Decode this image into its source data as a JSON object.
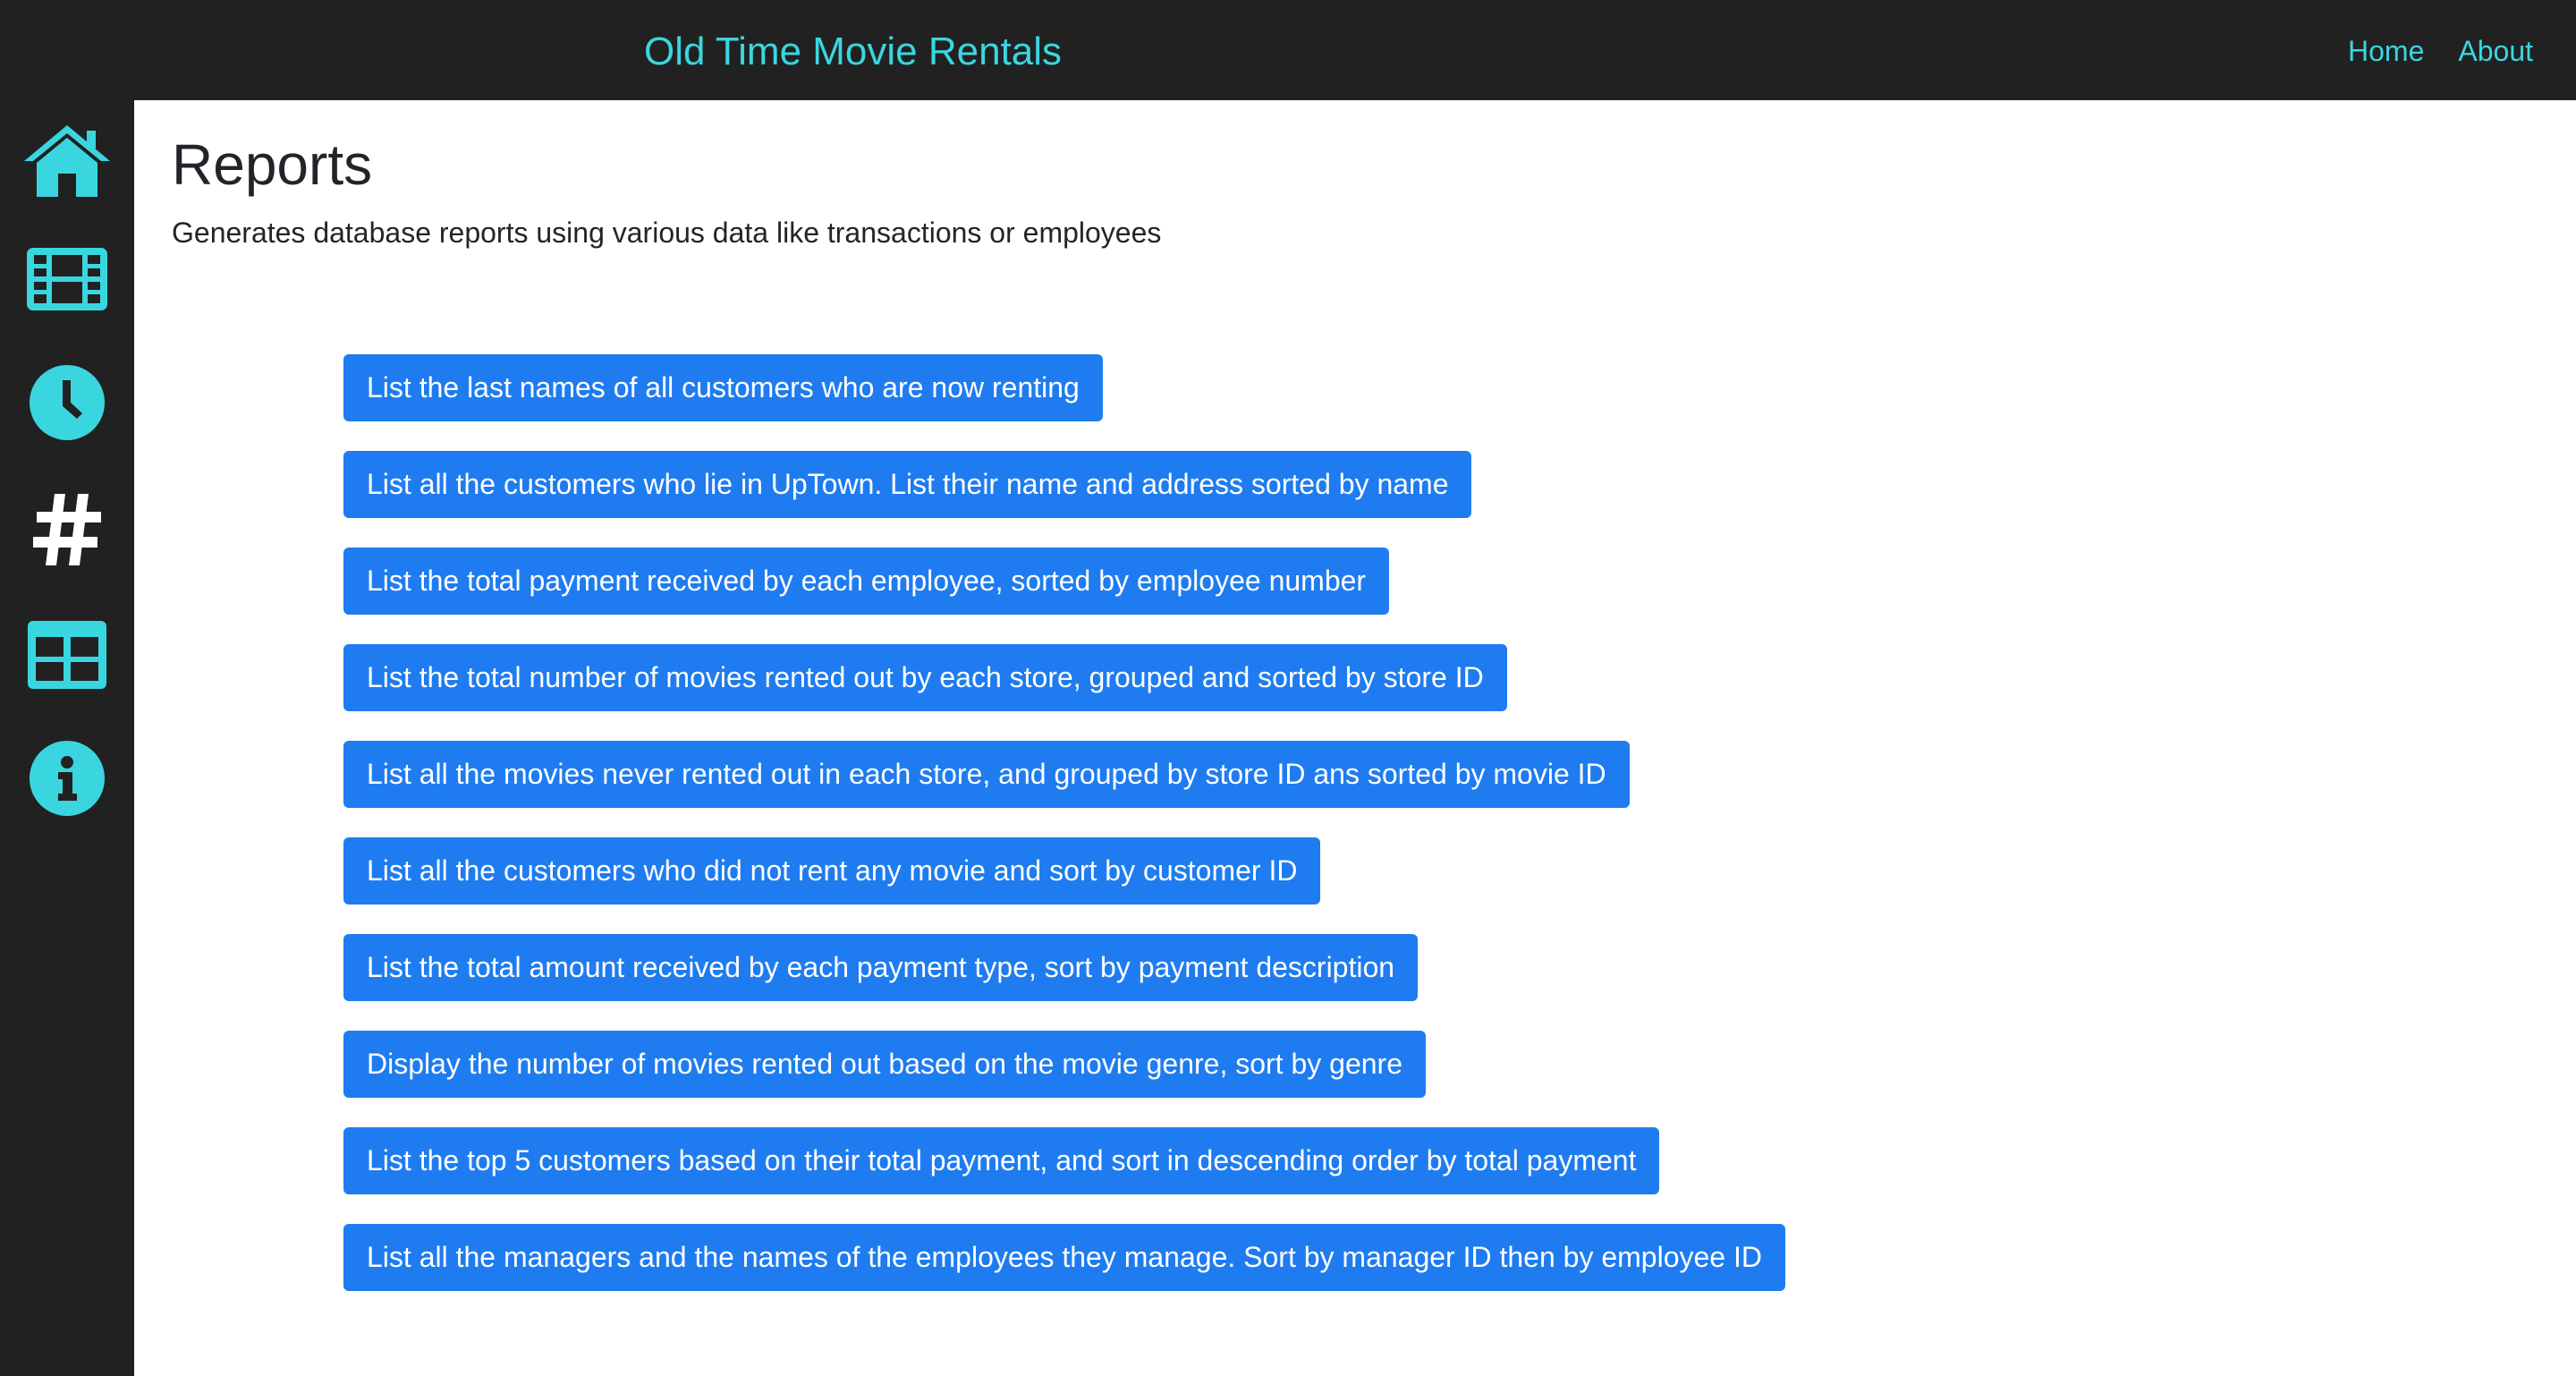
{
  "header": {
    "brand": "Old Time Movie Rentals",
    "nav": [
      {
        "label": "Home"
      },
      {
        "label": "About"
      }
    ]
  },
  "sidebar": {
    "icons": [
      "home-icon",
      "film-icon",
      "clock-icon",
      "hashtag-icon",
      "table-icon",
      "info-icon"
    ],
    "accent_color": "#3ad6e0"
  },
  "main": {
    "title": "Reports",
    "description": "Generates database reports using various data like transactions or employees",
    "reports": [
      {
        "label": "List the last names of all customers who are now renting"
      },
      {
        "label": "List all the customers who lie in UpTown. List their name and address sorted by name"
      },
      {
        "label": "List the total payment received by each employee, sorted by employee number"
      },
      {
        "label": "List the total number of movies rented out by each store, grouped and sorted by store ID"
      },
      {
        "label": "List all the movies never rented out in each store, and grouped by store ID ans sorted by movie ID"
      },
      {
        "label": "List all the customers who did not rent any movie and sort by customer ID"
      },
      {
        "label": "List the total amount received by each payment type, sort by payment description"
      },
      {
        "label": "Display the number of movies rented out based on the movie genre, sort by genre"
      },
      {
        "label": "List the top 5 customers based on their total payment, and sort in descending order by total payment"
      },
      {
        "label": "List all the managers and the names of the employees they manage. Sort by manager ID then by employee ID"
      }
    ]
  },
  "colors": {
    "dark_bg": "#212121",
    "accent": "#3ad6e0",
    "button_bg": "#1f7cf0",
    "button_text": "#ffffff"
  }
}
